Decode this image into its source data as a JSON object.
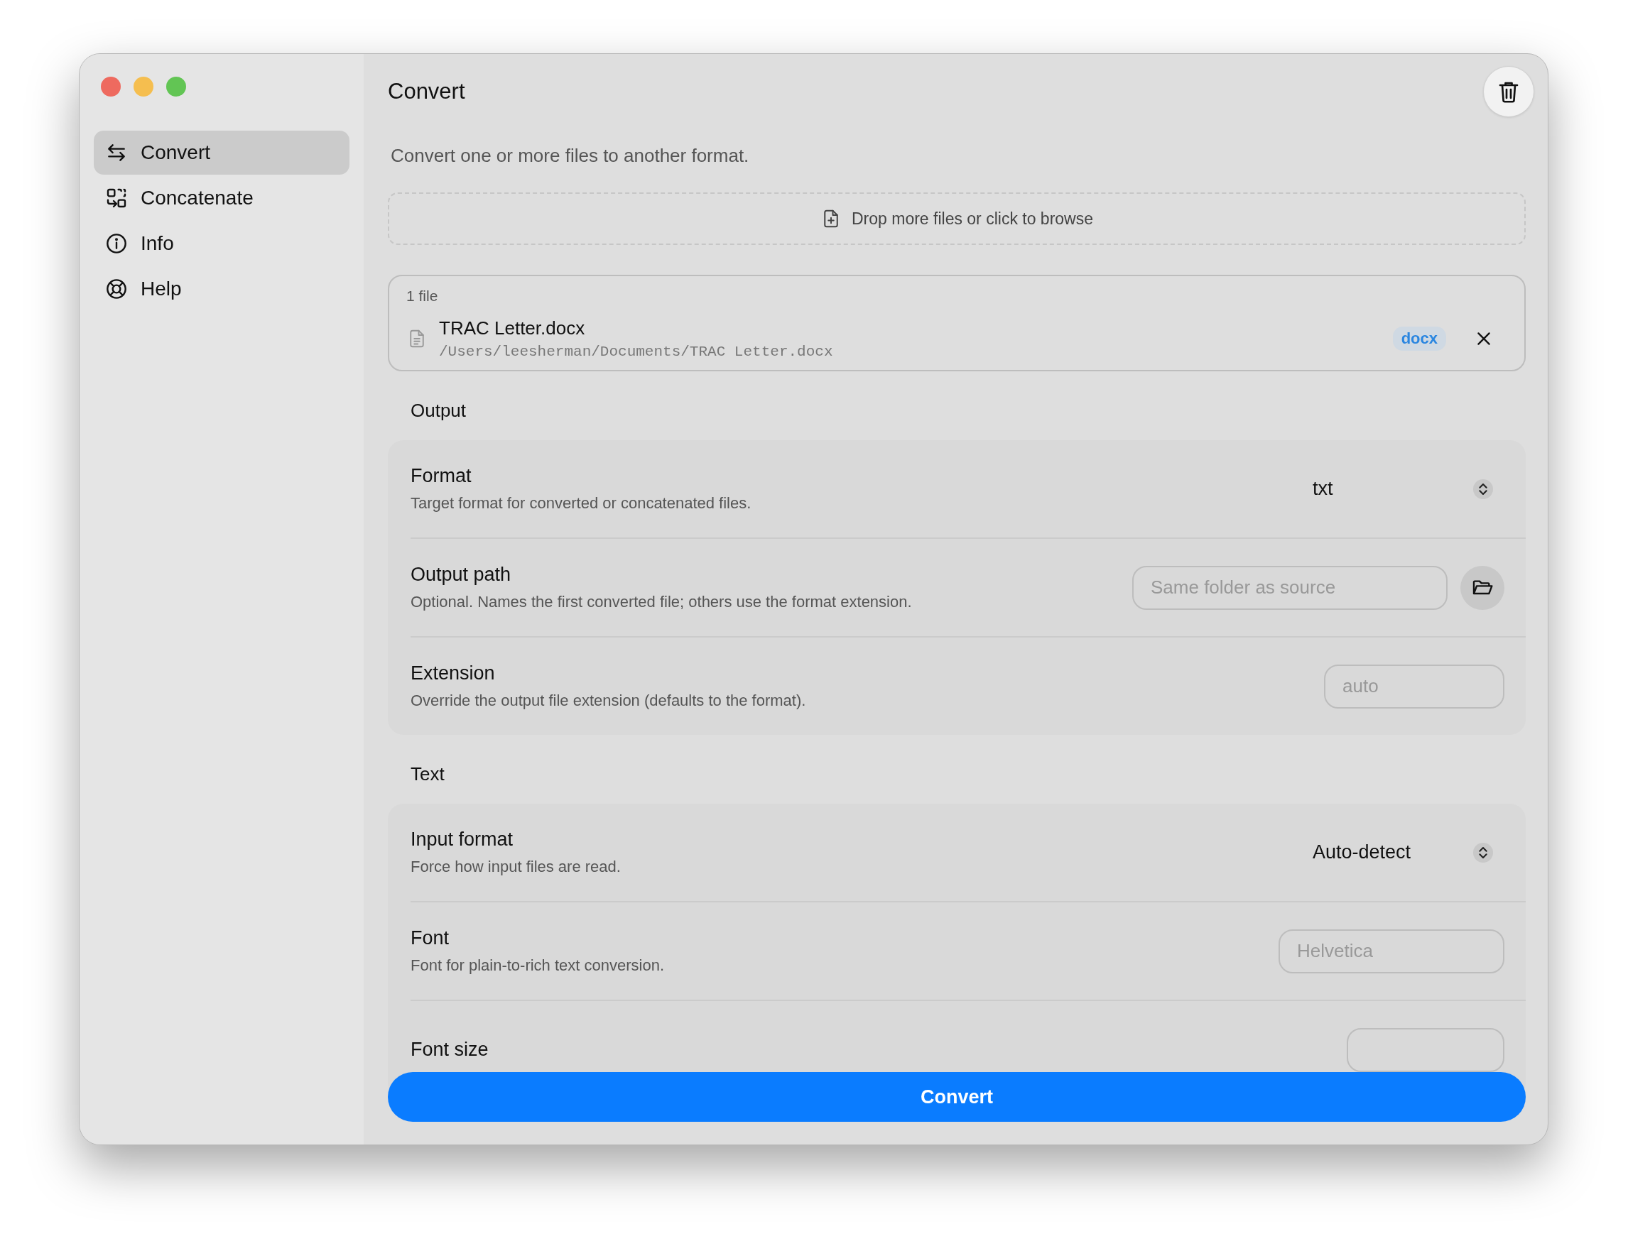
{
  "window": {
    "title": "Convert"
  },
  "sidebar": {
    "items": [
      {
        "label": "Convert",
        "selected": true
      },
      {
        "label": "Concatenate",
        "selected": false
      },
      {
        "label": "Info",
        "selected": false
      },
      {
        "label": "Help",
        "selected": false
      }
    ]
  },
  "description": "Convert one or more files to another format.",
  "dropzone": {
    "label": "Drop more files or click to browse"
  },
  "files": {
    "count": "1 file",
    "items": [
      {
        "name": "TRAC Letter.docx",
        "path": "/Users/leesherman/Documents/TRAC Letter.docx",
        "badge": "docx"
      }
    ]
  },
  "sections": [
    {
      "title": "Output",
      "rows": [
        {
          "kind": "select",
          "label": "Format",
          "hint": "Target format for converted or concatenated files.",
          "value": "txt"
        },
        {
          "kind": "path",
          "label": "Output path",
          "hint": "Optional. Names the first converted file; others use the format extension.",
          "placeholder": "Same folder as source"
        },
        {
          "kind": "input",
          "label": "Extension",
          "hint": "Override the output file extension (defaults to the format).",
          "placeholder": "auto"
        }
      ]
    },
    {
      "title": "Text",
      "rows": [
        {
          "kind": "select",
          "label": "Input format",
          "hint": "Force how input files are read.",
          "value": "Auto-detect"
        },
        {
          "kind": "input",
          "label": "Font",
          "hint": "Font for plain-to-rich text conversion.",
          "placeholder": "Helvetica"
        },
        {
          "kind": "stepper",
          "label": "Font size"
        }
      ]
    }
  ],
  "primary_button": "Convert"
}
